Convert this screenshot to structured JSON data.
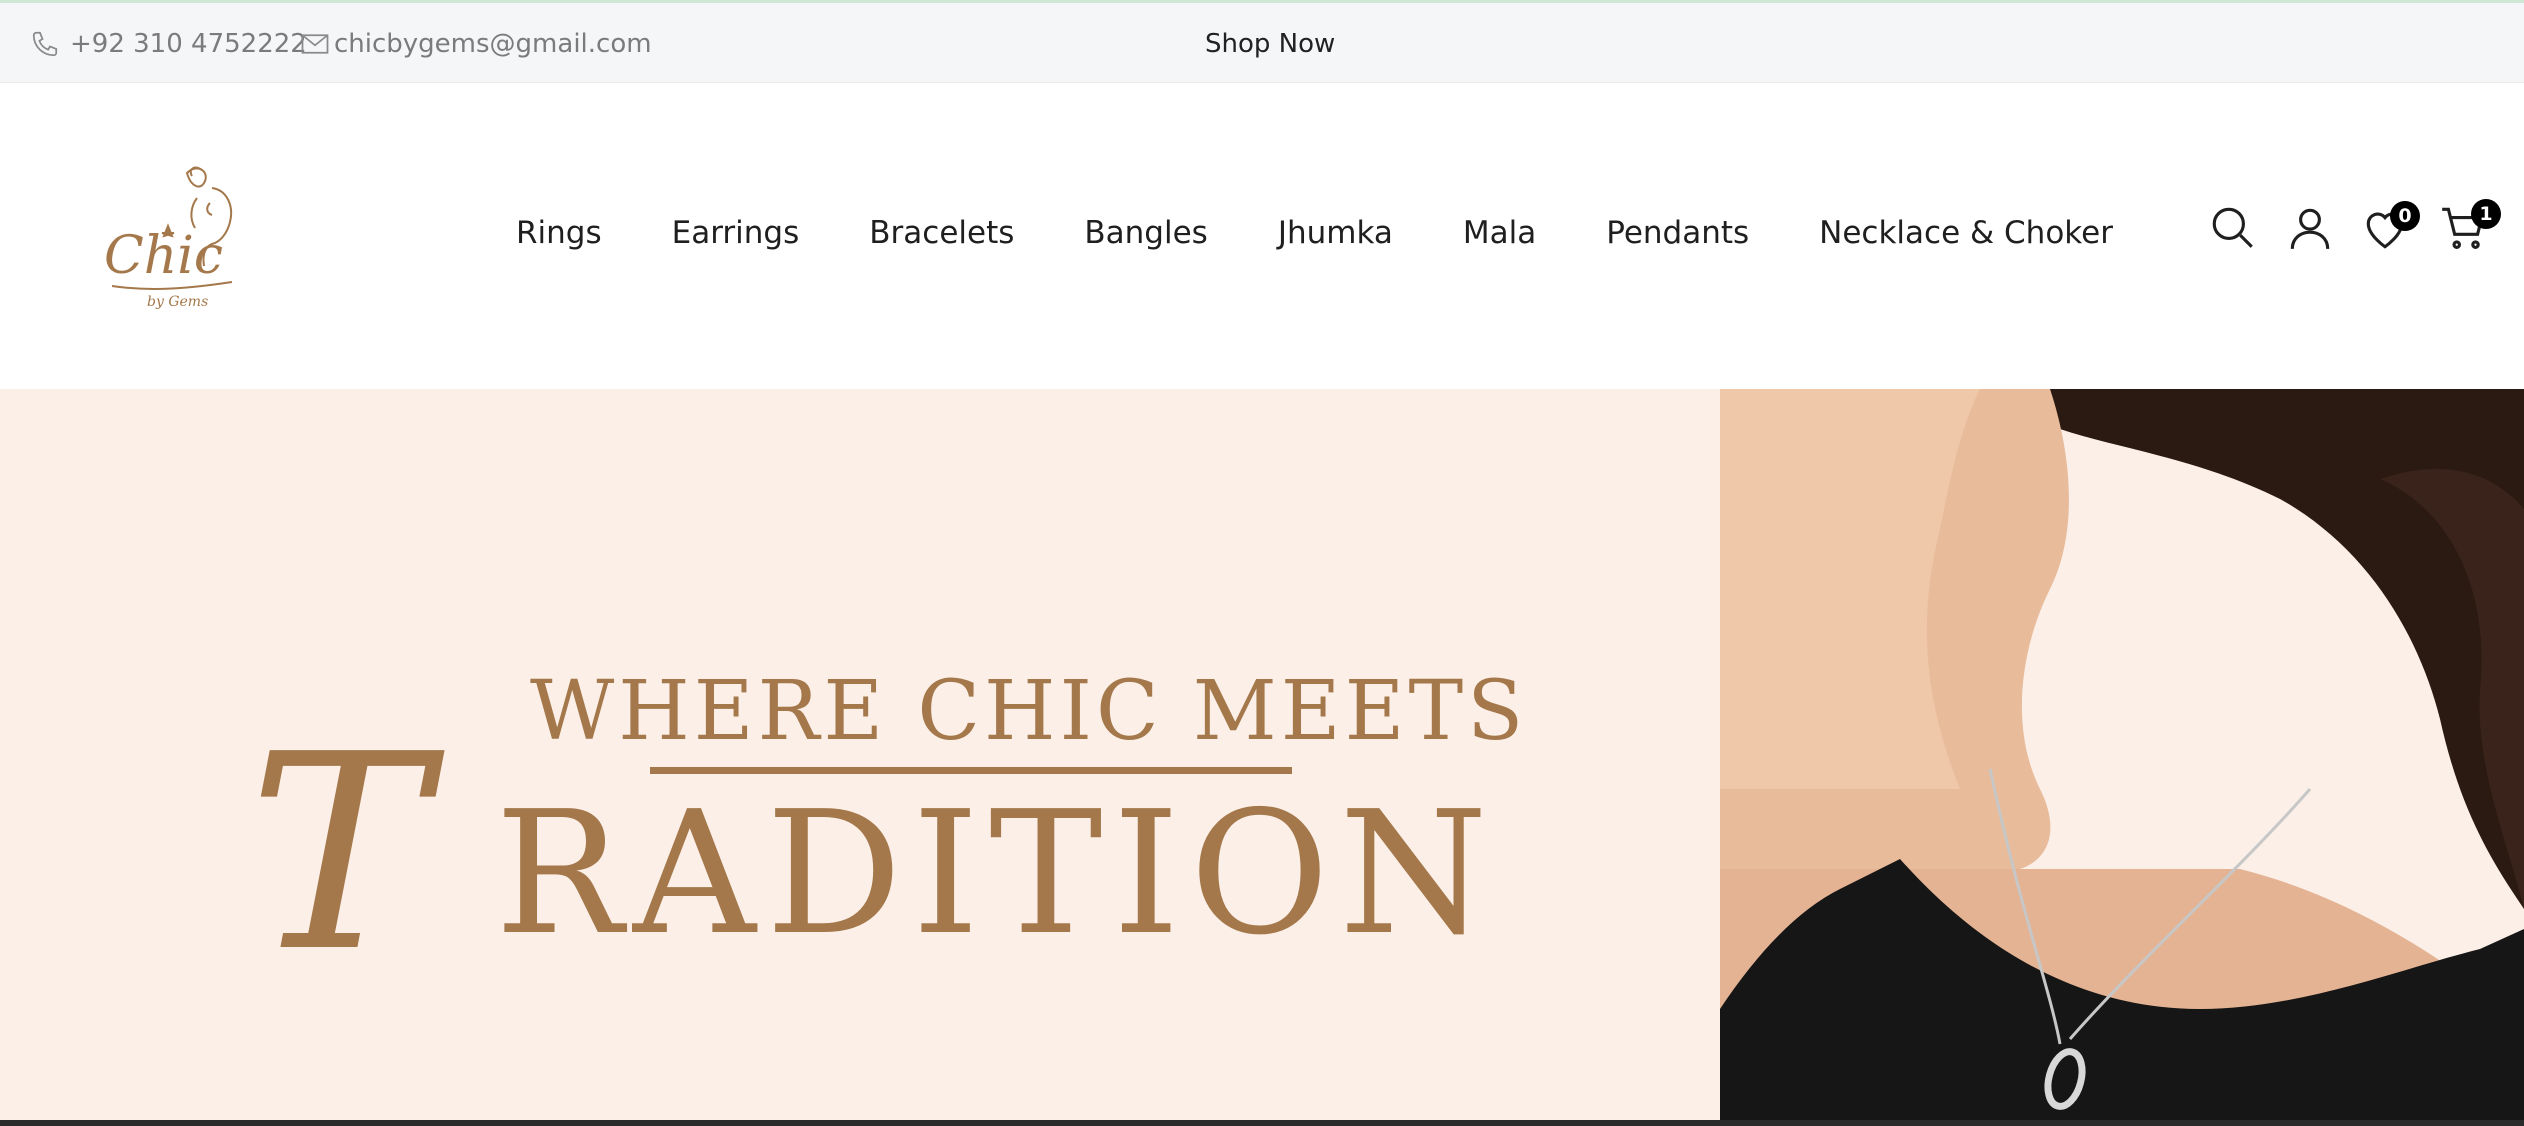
{
  "topbar": {
    "phone": "+92 310 4752222",
    "email": "chicbygems@gmail.com",
    "cta": "Shop Now"
  },
  "logo": {
    "text": "Chic",
    "subtext": "by Gems"
  },
  "nav": {
    "items": [
      "Rings",
      "Earrings",
      "Bracelets",
      "Bangles",
      "Jhumka",
      "Mala",
      "Pendants",
      "Necklace & Choker"
    ]
  },
  "header_icons": {
    "wishlist_count": "0",
    "cart_count": "1",
    "icons": [
      "search-icon",
      "account-icon",
      "heart-icon",
      "cart-icon"
    ]
  },
  "hero": {
    "headline": "WHERE CHIC MEETS",
    "script_letter": "T",
    "big_word": "RADITION"
  },
  "colors": {
    "accent_gold": "#a4784a",
    "hero_bg": "#fbefe8",
    "topbar_bg": "#f5f6f8",
    "badge": "#000000"
  }
}
